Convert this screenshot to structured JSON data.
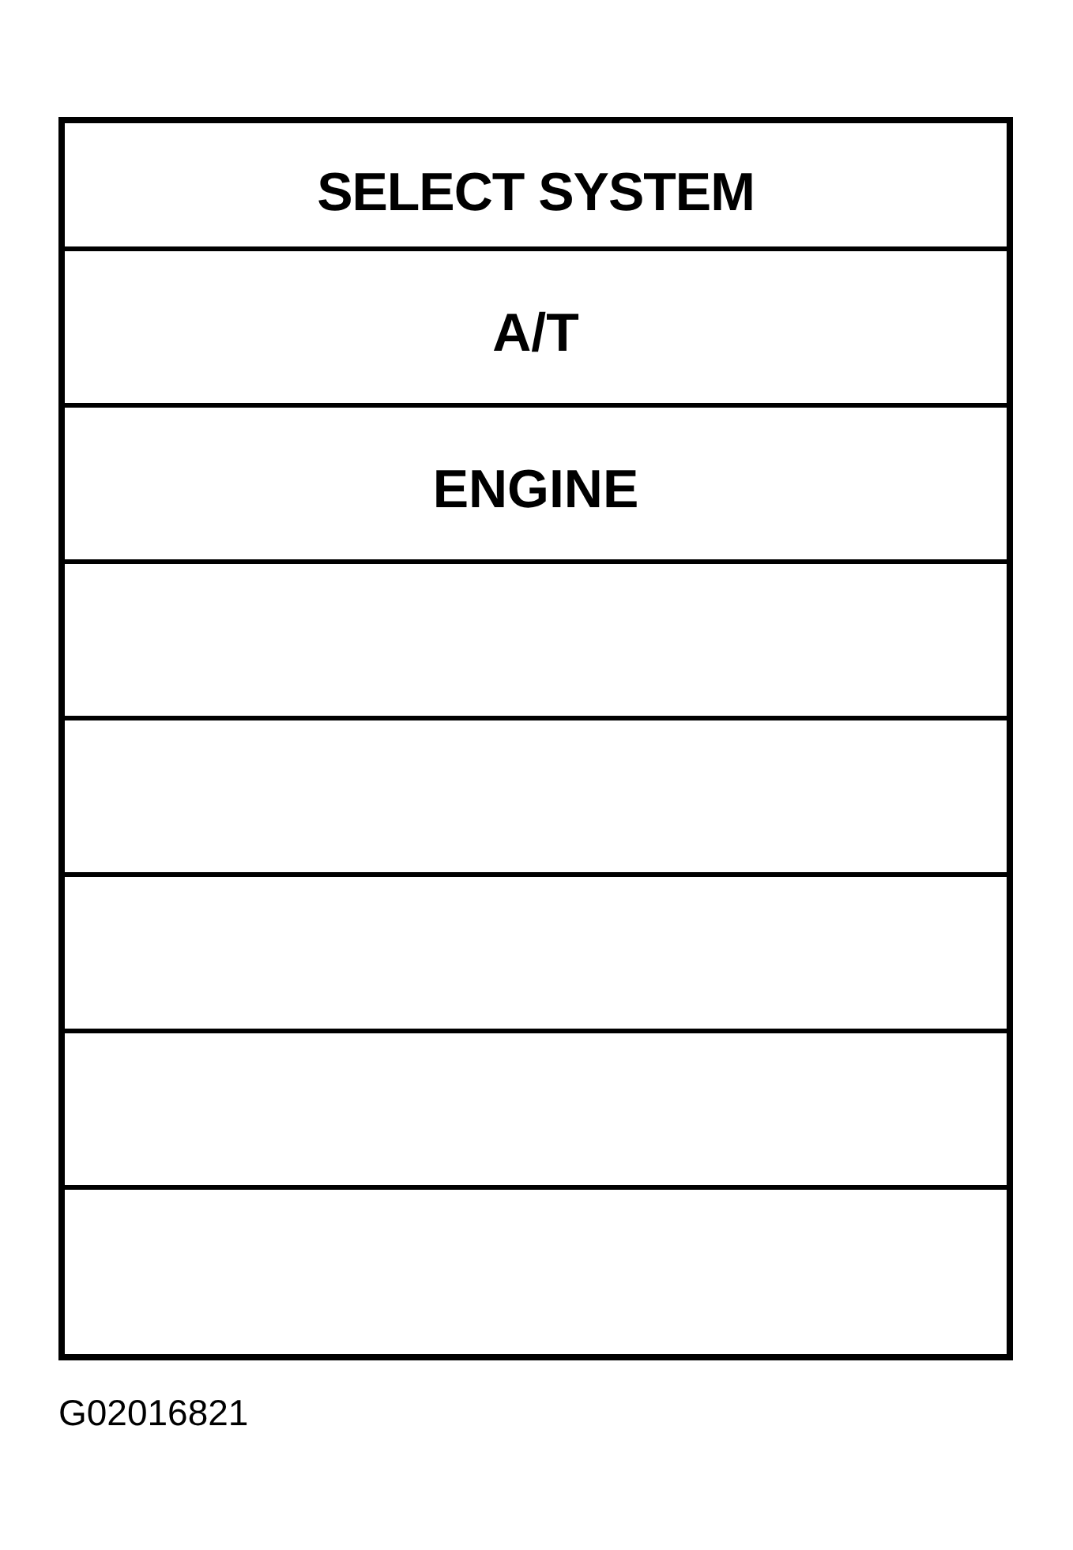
{
  "panel": {
    "title": "SELECT SYSTEM",
    "rows": [
      {
        "kind": "system",
        "label": "A/T"
      },
      {
        "kind": "system",
        "label": "ENGINE"
      },
      {
        "kind": "blank"
      },
      {
        "kind": "blank"
      },
      {
        "kind": "blank"
      },
      {
        "kind": "blank"
      },
      {
        "kind": "blank"
      }
    ]
  },
  "figure_id": "G02016821"
}
